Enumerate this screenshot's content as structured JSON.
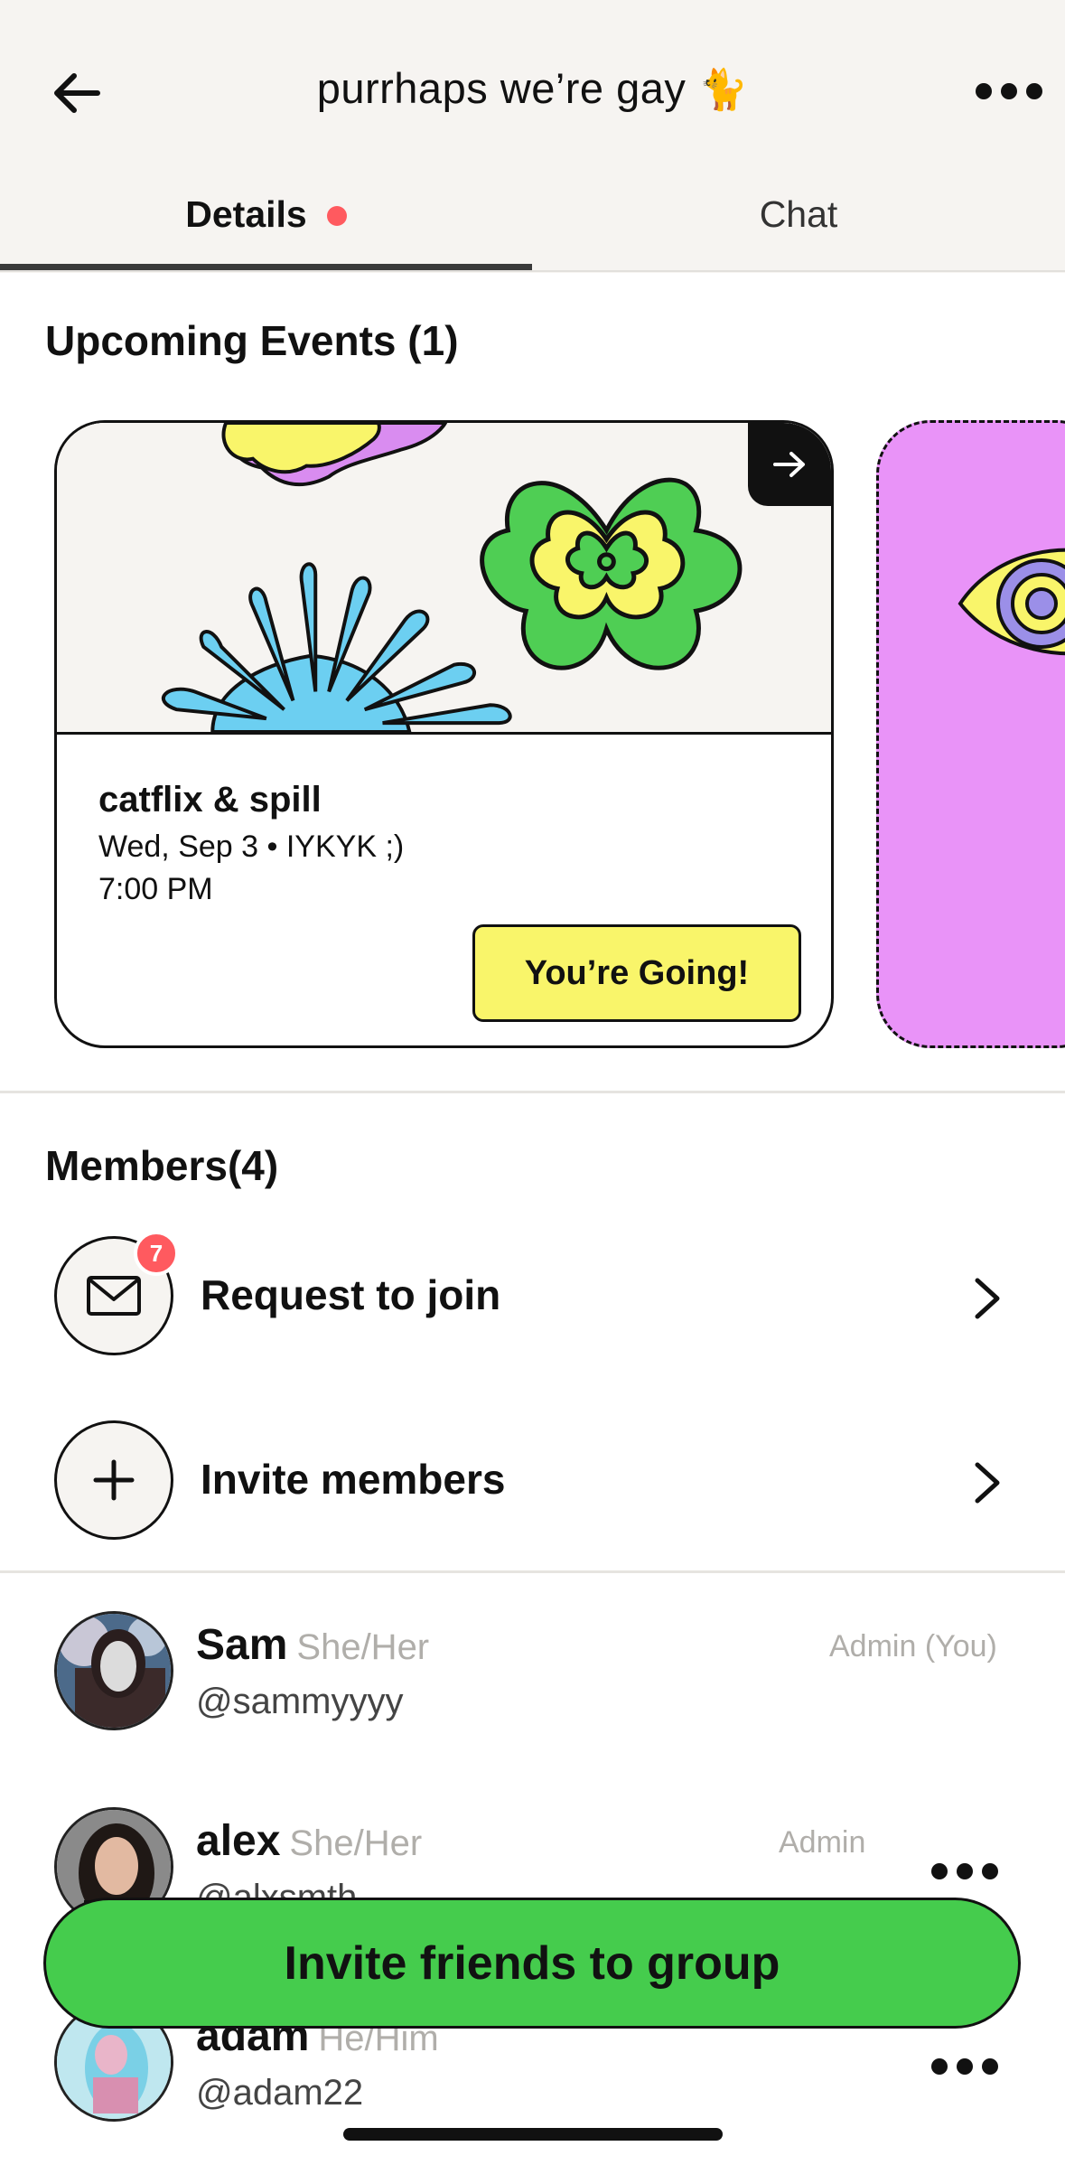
{
  "header": {
    "title": "purrhaps we’re gay",
    "title_emoji": "🐈",
    "back_icon": "arrow-left-icon",
    "more_icon": "more-horizontal-icon"
  },
  "tabs": [
    {
      "label": "Details",
      "active": true,
      "has_dot": true
    },
    {
      "label": "Chat",
      "active": false
    }
  ],
  "events": {
    "title": "Upcoming Events (1)",
    "items": [
      {
        "name": "catflix & spill",
        "date_line": "Wed, Sep 3 • IYKYK ;)",
        "time": "7:00 PM",
        "button_label": "You’re Going!",
        "open_icon": "arrow-right-icon"
      }
    ]
  },
  "members": {
    "title": "Members(4)",
    "request": {
      "label": "Request to join",
      "badge": "7",
      "icon": "mail-icon"
    },
    "invite": {
      "label": "Invite members",
      "icon": "plus-icon"
    },
    "list": [
      {
        "name": "Sam",
        "pronouns": "She/Her",
        "handle": "@sammyyyy",
        "role": "Admin (You)"
      },
      {
        "name": "alex",
        "pronouns": "She/Her",
        "handle": "@alxsmth",
        "role": "Admin"
      },
      {
        "name": "adam",
        "pronouns": "He/Him",
        "handle": "@adam22",
        "role": ""
      }
    ]
  },
  "cta": {
    "label": "Invite friends to group"
  },
  "colors": {
    "accent_green": "#45cc4d",
    "going_yellow": "#f9f56a",
    "badge_red": "#ff5a5f",
    "event_purple": "#e993f8",
    "header_bg": "#f6f4f1"
  }
}
